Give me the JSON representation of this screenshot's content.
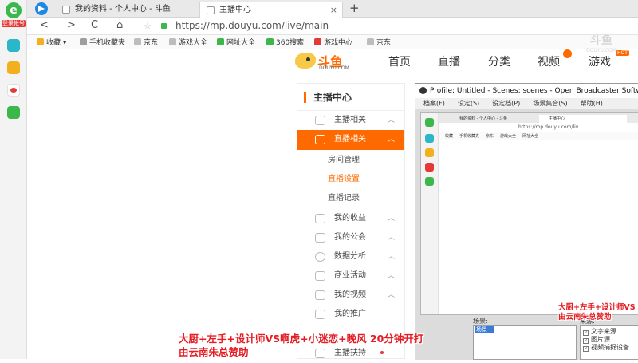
{
  "sidebar": {
    "login_label": "登录帐号",
    "icons": [
      "apps-icon",
      "favorites-star-icon",
      "weibo-icon",
      "mail-icon"
    ]
  },
  "tabs": [
    {
      "label": "我的资料 - 个人中心 - 斗鱼"
    },
    {
      "label": "主播中心"
    }
  ],
  "toolbar": {
    "back": "<",
    "forward": ">",
    "reload": "C",
    "home": "⌂",
    "url": "https://mp.douyu.com/live/main"
  },
  "bookmarks": [
    {
      "label": "收藏",
      "color": "#f2b01e"
    },
    {
      "label": "手机收藏夹",
      "color": "#9e9e9e"
    },
    {
      "label": "京东",
      "color": "#bdbdbd"
    },
    {
      "label": "游戏大全",
      "color": "#bdbdbd"
    },
    {
      "label": "网址大全",
      "color": "#3cb84b"
    },
    {
      "label": "360搜索",
      "color": "#3cb84b"
    },
    {
      "label": "游戏中心",
      "color": "#e53935"
    },
    {
      "label": "京东",
      "color": "#bdbdbd"
    }
  ],
  "douyu": {
    "logo": "斗鱼",
    "logo_sub": "DOUYU.COM",
    "nav": [
      "首页",
      "直播",
      "分类",
      "视频",
      "游戏"
    ],
    "hot": "HOT",
    "watermark": "斗鱼",
    "watermark_sub": "DOUYU.COM",
    "brand_color": "#ff6a00"
  },
  "menu": {
    "title": "主播中心",
    "items": [
      {
        "label": "主播相关"
      },
      {
        "label": "直播相关"
      },
      {
        "label": "我的收益"
      },
      {
        "label": "我的公会"
      },
      {
        "label": "数据分析"
      },
      {
        "label": "商业活动"
      },
      {
        "label": "我的视频"
      },
      {
        "label": "我的推广"
      },
      {
        "label": "主播扶持"
      }
    ],
    "subitems": [
      "房间管理",
      "直播设置",
      "直播记录"
    ]
  },
  "obs": {
    "title": "Profile: Untitled - Scenes: scenes - Open Broadcaster Software",
    "menu": [
      "档案(F)",
      "设定(S)",
      "设定档(P)",
      "场景集合(S)",
      "帮助(H)"
    ],
    "mini_tabs": [
      "我的资料 - 个人中心 - 斗鱼",
      "主播中心"
    ],
    "mini_url": "https://mp.douyu.com/liv",
    "mini_bookmarks": [
      "收藏",
      "手机收藏夹",
      "京东",
      "游戏大全",
      "网址大全"
    ],
    "scenes_label": "场景:",
    "scene_selected": "场景",
    "sources_label": "来源:",
    "sources": [
      "文字来源",
      "图片源",
      "视频捕捉设备"
    ]
  },
  "captions": {
    "main_line1": "大厨+左手+设计师VS啊虎+小迷恋+晚风 20分钟开打",
    "main_line2": "由云南朱总赞助",
    "side_line1": "大厨+左手+设计师VS",
    "side_line2": "由云南朱总赞助",
    "color": "#e51c23"
  }
}
